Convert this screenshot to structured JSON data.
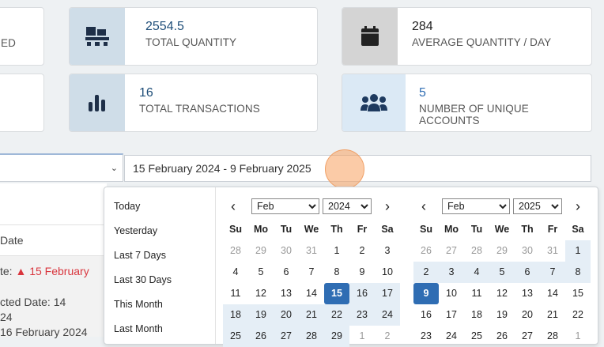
{
  "cards": [
    {
      "id": "partial-left-top",
      "value": "",
      "label": "ED"
    },
    {
      "id": "total-quantity",
      "value": "2554.5",
      "label": "TOTAL QUANTITY",
      "icon": "pallet-icon",
      "bg": "#cfdde8"
    },
    {
      "id": "average-quantity",
      "value": "284",
      "label": "AVERAGE QUANTITY / DAY",
      "icon": "calendar-icon",
      "bg": "#d4d4d4"
    },
    {
      "id": "total-transactions",
      "value": "16",
      "label": "TOTAL TRANSACTIONS",
      "icon": "bar-chart-icon",
      "bg": "#cfdde8"
    },
    {
      "id": "unique-accounts",
      "value": "5",
      "label": "NUMBER OF UNIQUE ACCOUNTS",
      "icon": "users-icon",
      "bg": "#dbe9f5"
    }
  ],
  "date_range": {
    "value": "15 February 2024 - 9 February 2025"
  },
  "left_panel": {
    "header": "Date",
    "rows": [
      "te: ",
      "15 February",
      "cted Date: 14",
      "24",
      "16 February 2024"
    ]
  },
  "ranges": [
    "Today",
    "Yesterday",
    "Last 7 Days",
    "Last 30 Days",
    "This Month",
    "Last Month"
  ],
  "calendars": [
    {
      "month": "Feb",
      "year": "2024",
      "dow": [
        "Su",
        "Mo",
        "Tu",
        "We",
        "Th",
        "Fr",
        "Sa"
      ],
      "weeks": [
        [
          "28",
          "29",
          "30",
          "31",
          "1",
          "2",
          "3"
        ],
        [
          "4",
          "5",
          "6",
          "7",
          "8",
          "9",
          "10"
        ],
        [
          "11",
          "12",
          "13",
          "14",
          "15",
          "16",
          "17"
        ],
        [
          "18",
          "19",
          "20",
          "21",
          "22",
          "23",
          "24"
        ],
        [
          "25",
          "26",
          "27",
          "28",
          "29",
          "1",
          "2"
        ]
      ]
    },
    {
      "month": "Feb",
      "year": "2025",
      "dow": [
        "Su",
        "Mo",
        "Tu",
        "We",
        "Th",
        "Fr",
        "Sa"
      ],
      "weeks": [
        [
          "26",
          "27",
          "28",
          "29",
          "30",
          "31",
          "1"
        ],
        [
          "2",
          "3",
          "4",
          "5",
          "6",
          "7",
          "8"
        ],
        [
          "9",
          "10",
          "11",
          "12",
          "13",
          "14",
          "15"
        ],
        [
          "16",
          "17",
          "18",
          "19",
          "20",
          "21",
          "22"
        ],
        [
          "23",
          "24",
          "25",
          "26",
          "27",
          "28",
          "1"
        ]
      ]
    }
  ],
  "colors": {
    "accent": "#2f6db3",
    "alert": "#d9363e",
    "range_bg": "#e5eef6"
  }
}
